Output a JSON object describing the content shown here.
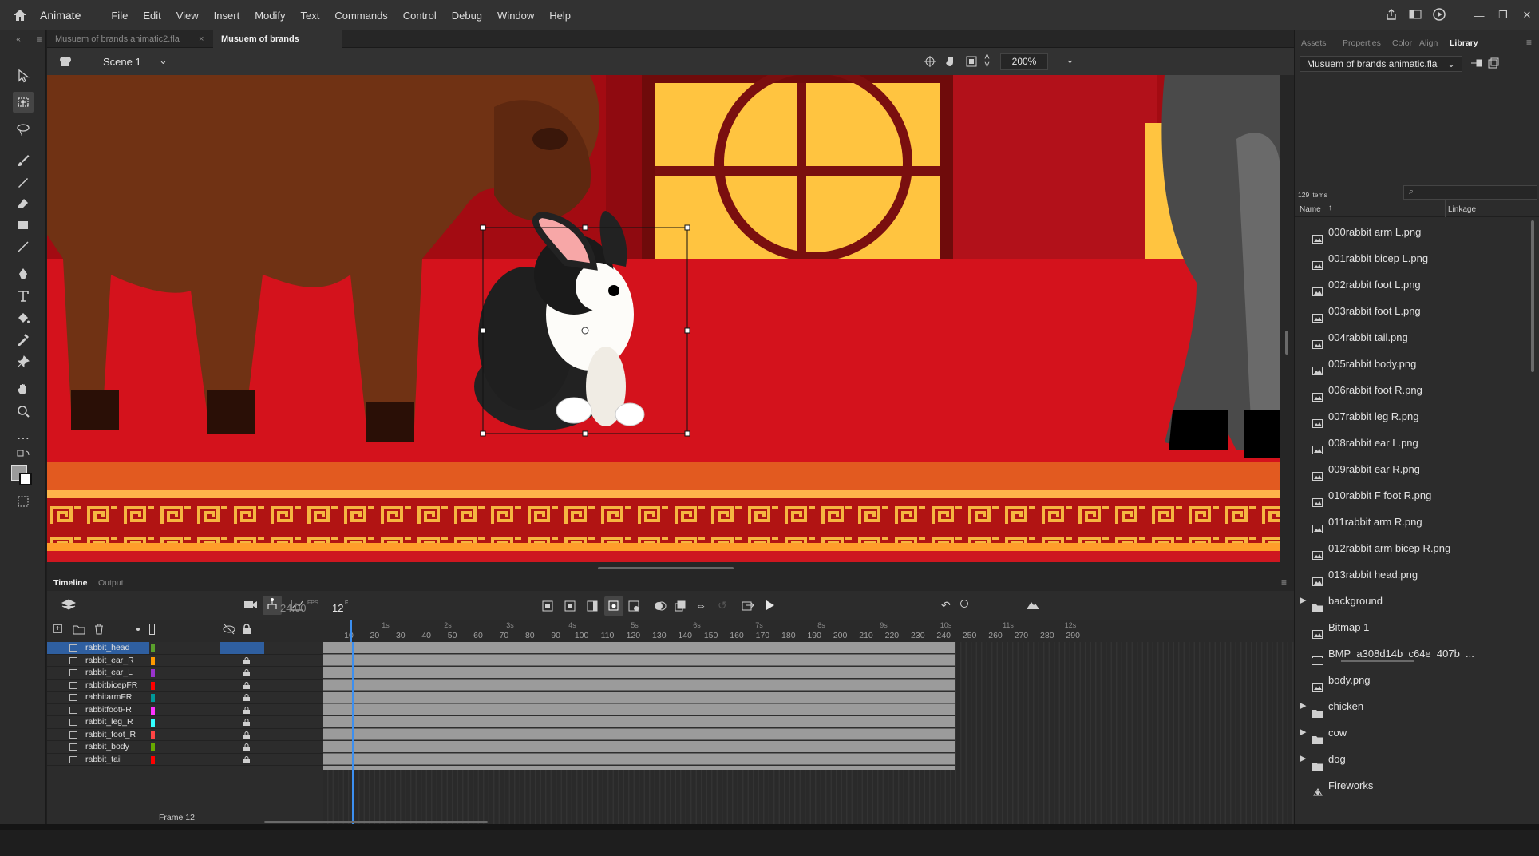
{
  "app": {
    "name": "Animate"
  },
  "menu": [
    "File",
    "Edit",
    "View",
    "Insert",
    "Modify",
    "Text",
    "Commands",
    "Control",
    "Debug",
    "Window",
    "Help"
  ],
  "doc_tabs": [
    {
      "label": "Musuem of brands animatic2.fla",
      "active": false
    },
    {
      "label": "Musuem of brands animatic.fla*",
      "active": true
    }
  ],
  "scene": {
    "name": "Scene 1",
    "zoom": "200%"
  },
  "timeline": {
    "tabs": [
      "Timeline",
      "Output"
    ],
    "fps": "24.00",
    "fps_unit": "FPS",
    "current_frame": "12",
    "frame_unit": "F",
    "frame_label": "Frame",
    "frame_value": "12",
    "ruler_ticks": [
      "10",
      "20",
      "30",
      "40",
      "50",
      "60",
      "70",
      "80",
      "90",
      "100",
      "110",
      "120",
      "130",
      "140",
      "150",
      "160",
      "170",
      "180",
      "190",
      "200",
      "210",
      "220",
      "230",
      "240",
      "250",
      "260",
      "270",
      "280",
      "290"
    ],
    "seconds": [
      "1s",
      "2s",
      "3s",
      "4s",
      "5s",
      "6s",
      "7s",
      "8s",
      "9s",
      "10s",
      "11s",
      "12s"
    ],
    "layers": [
      {
        "name": "rabbit_head",
        "color": "#5aa02c",
        "selected": true,
        "locked": false
      },
      {
        "name": "rabbit_ear_R",
        "color": "#ff9900",
        "selected": false,
        "locked": true
      },
      {
        "name": "rabbit_ear_L",
        "color": "#9933cc",
        "selected": false,
        "locked": true
      },
      {
        "name": "rabbitbicepFR",
        "color": "#ff0000",
        "selected": false,
        "locked": true
      },
      {
        "name": "rabbitarmFR",
        "color": "#009999",
        "selected": false,
        "locked": true
      },
      {
        "name": "rabbitfootFR",
        "color": "#ff33ff",
        "selected": false,
        "locked": true
      },
      {
        "name": "rabbit_leg_R",
        "color": "#33ffff",
        "selected": false,
        "locked": true
      },
      {
        "name": "rabbit_foot_R",
        "color": "#ff4444",
        "selected": false,
        "locked": true
      },
      {
        "name": "rabbit_body",
        "color": "#66aa00",
        "selected": false,
        "locked": true
      },
      {
        "name": "rabbit_tail",
        "color": "#ff0000",
        "selected": false,
        "locked": true
      }
    ]
  },
  "library": {
    "tabs": [
      "Assets",
      "Properties",
      "Color",
      "Align",
      "Library"
    ],
    "active_tab": "Library",
    "document": "Musuem of brands animatic.fla",
    "count": "129 items",
    "col_name": "Name",
    "col_linkage": "Linkage",
    "items": [
      {
        "name": "000rabbit arm L.png",
        "kind": "image"
      },
      {
        "name": "001rabbit bicep L.png",
        "kind": "image"
      },
      {
        "name": "002rabbit foot L.png",
        "kind": "image"
      },
      {
        "name": "003rabbit foot L.png",
        "kind": "image"
      },
      {
        "name": "004rabbit tail.png",
        "kind": "image"
      },
      {
        "name": "005rabbit body.png",
        "kind": "image"
      },
      {
        "name": "006rabbit foot R.png",
        "kind": "image"
      },
      {
        "name": "007rabbit leg R.png",
        "kind": "image"
      },
      {
        "name": "008rabbit ear L.png",
        "kind": "image"
      },
      {
        "name": "009rabbit ear R.png",
        "kind": "image"
      },
      {
        "name": "010rabbit F foot R.png",
        "kind": "image"
      },
      {
        "name": "011rabbit arm R.png",
        "kind": "image"
      },
      {
        "name": "012rabbit arm bicep R.png",
        "kind": "image"
      },
      {
        "name": "013rabbit head.png",
        "kind": "image"
      },
      {
        "name": "background",
        "kind": "folder"
      },
      {
        "name": "Bitmap 1",
        "kind": "image"
      },
      {
        "name": "BMP_a308d14b_c64e_407b_...",
        "kind": "image"
      },
      {
        "name": "body.png",
        "kind": "image"
      },
      {
        "name": "chicken",
        "kind": "folder"
      },
      {
        "name": "cow",
        "kind": "folder"
      },
      {
        "name": "dog",
        "kind": "folder"
      },
      {
        "name": "Fireworks",
        "kind": "symbol"
      }
    ]
  }
}
